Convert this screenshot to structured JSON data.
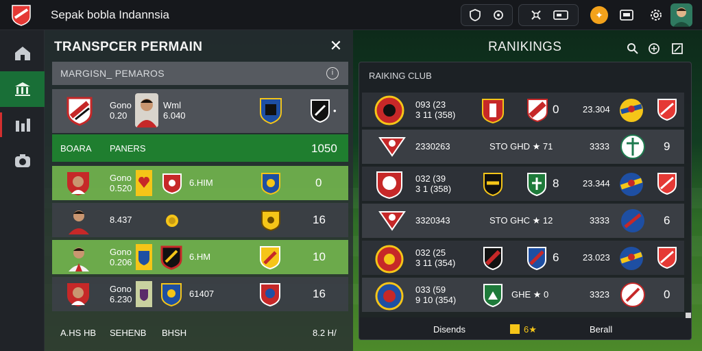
{
  "app": {
    "title": "Sepak bobla Indannsia",
    "colors": {
      "accent_green": "#196f37",
      "brand_red": "#d32f2f",
      "coin": "#f3a21b"
    }
  },
  "topbar": {
    "pill1_icons": [
      "shield-icon",
      "whistle-icon"
    ],
    "pill2_icons": [
      "settings-icon",
      "ticket-icon"
    ],
    "right_icons": [
      "coin-icon",
      "card-icon",
      "gear-icon",
      "avatar"
    ]
  },
  "sidebar": {
    "items": [
      {
        "name": "home",
        "icon": "home-icon"
      },
      {
        "name": "bank",
        "icon": "bank-icon",
        "active": true
      },
      {
        "name": "stats",
        "icon": "stats-icon"
      },
      {
        "name": "camera",
        "icon": "camera-icon"
      }
    ]
  },
  "transfer": {
    "title": "TRANSPCER PERMAIN",
    "subhead": "MARGISN_ PEMAROS",
    "info": "i",
    "featured": {
      "line1": "Gono",
      "line2": "0.20",
      "name1": "Wml",
      "name2": "6.040"
    },
    "header": {
      "col1": "BOARA",
      "col2": "PANERS",
      "col3": "1050"
    },
    "rows": [
      {
        "l1": "Gono",
        "l2": "0.520",
        "name": "6.HIM",
        "val": "0"
      },
      {
        "l1": "",
        "l2": "8.437",
        "name": "",
        "val": "16"
      },
      {
        "l1": "Gono",
        "l2": "0.206",
        "name": "6.HM",
        "val": "10"
      },
      {
        "l1": "Gono",
        "l2": "6.230",
        "name": "61407",
        "val": "16"
      }
    ],
    "footer": {
      "a": "A.HS HB",
      "b": "SEHENB",
      "c": "BHSH",
      "d": "8.2 H/"
    }
  },
  "rankings": {
    "title": "RANIKINGS",
    "head": "RAIKING CLUB",
    "rows": [
      {
        "n1": "093 (23",
        "n2": "3 11 (358)",
        "mid": "",
        "num": "0",
        "score": "23.304",
        "last": ""
      },
      {
        "n1": "2330263",
        "n2": "",
        "mid": "STO GHD ★ 71",
        "num": "",
        "score": "3333",
        "last": "9"
      },
      {
        "n1": "032 (39",
        "n2": "3 1 (358)",
        "mid": "",
        "num": "8",
        "score": "23.344",
        "last": ""
      },
      {
        "n1": "3320343",
        "n2": "",
        "mid": "STO GHC ★ 12",
        "num": "",
        "score": "3333",
        "last": "6"
      },
      {
        "n1": "032 (25",
        "n2": "3 11 (354)",
        "mid": "",
        "num": "6",
        "score": "23.023",
        "last": ""
      },
      {
        "n1": "033 (59",
        "n2": "9 10 (354)",
        "mid": "GHE ★ 0",
        "num": "",
        "score": "3323",
        "last": "0"
      }
    ],
    "footer": {
      "a": "Disends",
      "b": "6★",
      "c": "Berall"
    }
  }
}
